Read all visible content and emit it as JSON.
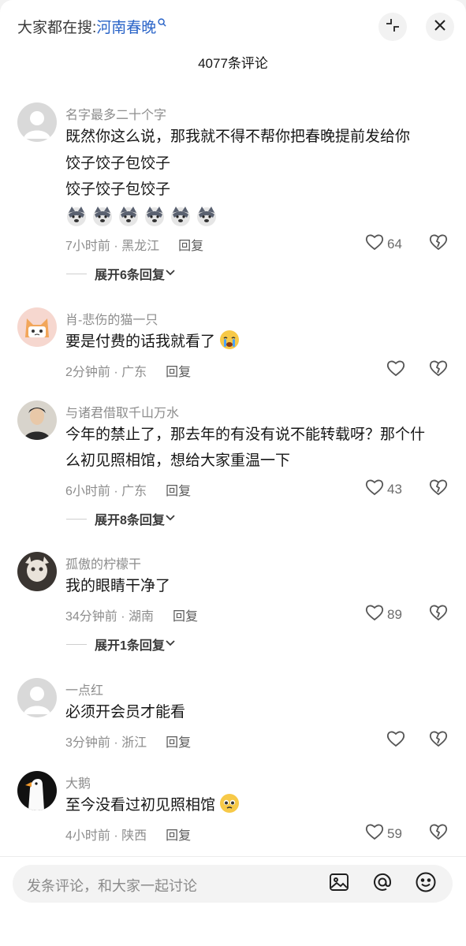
{
  "header": {
    "search_prefix": "大家都在搜:",
    "search_keyword": "河南春晚",
    "comment_count": "4077条评论"
  },
  "comments": [
    {
      "name": "名字最多二十个字",
      "lines": [
        "既然你这么说，那我就不得不帮你把春晚提前发给你",
        "饺子饺子包饺子",
        "饺子饺子包饺子"
      ],
      "meta": "7小时前 · 黑龙江",
      "reply": "回复",
      "likes": "64",
      "expand": "展开6条回复"
    },
    {
      "name": "肖-悲伤的猫一只",
      "lines": [
        "要是付费的话我就看了"
      ],
      "meta": "2分钟前 · 广东",
      "reply": "回复",
      "likes": "",
      "expand": ""
    },
    {
      "name": "与诸君借取千山万水",
      "lines": [
        "今年的禁止了，那去年的有没有说不能转载呀？那个什",
        "么初见照相馆，想给大家重温一下"
      ],
      "meta": "6小时前 · 广东",
      "reply": "回复",
      "likes": "43",
      "expand": "展开8条回复"
    },
    {
      "name": "孤傲的柠檬干",
      "lines": [
        "我的眼睛干净了"
      ],
      "meta": "34分钟前 · 湖南",
      "reply": "回复",
      "likes": "89",
      "expand": "展开1条回复"
    },
    {
      "name": "一点红",
      "lines": [
        "必须开会员才能看"
      ],
      "meta": "3分钟前 · 浙江",
      "reply": "回复",
      "likes": "",
      "expand": ""
    },
    {
      "name": "大鹅",
      "lines": [
        "至今没看过初见照相馆"
      ],
      "meta": "4小时前 · 陕西",
      "reply": "回复",
      "likes": "59",
      "expand": ""
    }
  ],
  "input": {
    "placeholder": "发条评论，和大家一起讨论"
  },
  "colors": {
    "accent": "#2a64c8",
    "muted": "#8d8d8d"
  }
}
